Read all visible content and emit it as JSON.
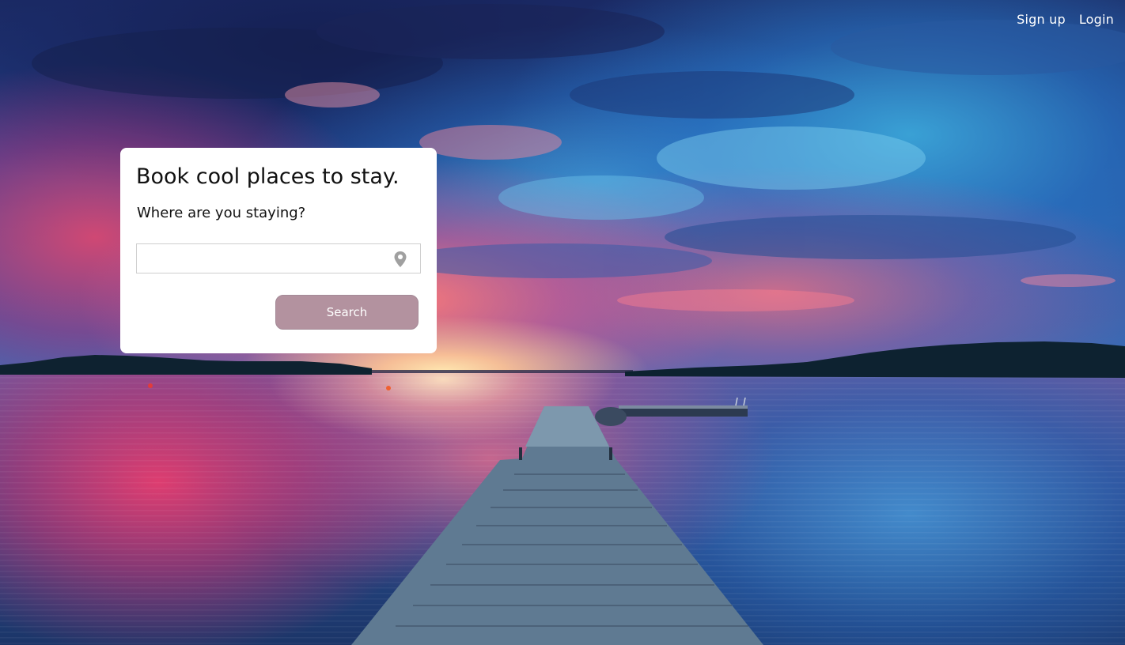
{
  "nav": {
    "signup_label": "Sign up",
    "login_label": "Login"
  },
  "search_card": {
    "title": "Book cool places to stay.",
    "question": "Where are you staying?",
    "input_value": "",
    "input_placeholder": "",
    "location_icon": "map-pin-icon",
    "search_button_label": "Search"
  },
  "background": {
    "scene": "lake-pier-sunset",
    "colors": {
      "sky_top": "#1c2a63",
      "sky_accent_blue": "#3caadc",
      "sunset_pink": "#e6466e",
      "sun_glow": "#ffe7b0",
      "water_deep": "#1b3568"
    }
  },
  "colors": {
    "card_background": "#ffffff",
    "title_text": "#111111",
    "button_background": "#b3929f",
    "button_text": "#ffffff",
    "nav_text": "#ffffff",
    "input_border": "#cfcfcf",
    "icon_gray": "#a0a0a0"
  }
}
